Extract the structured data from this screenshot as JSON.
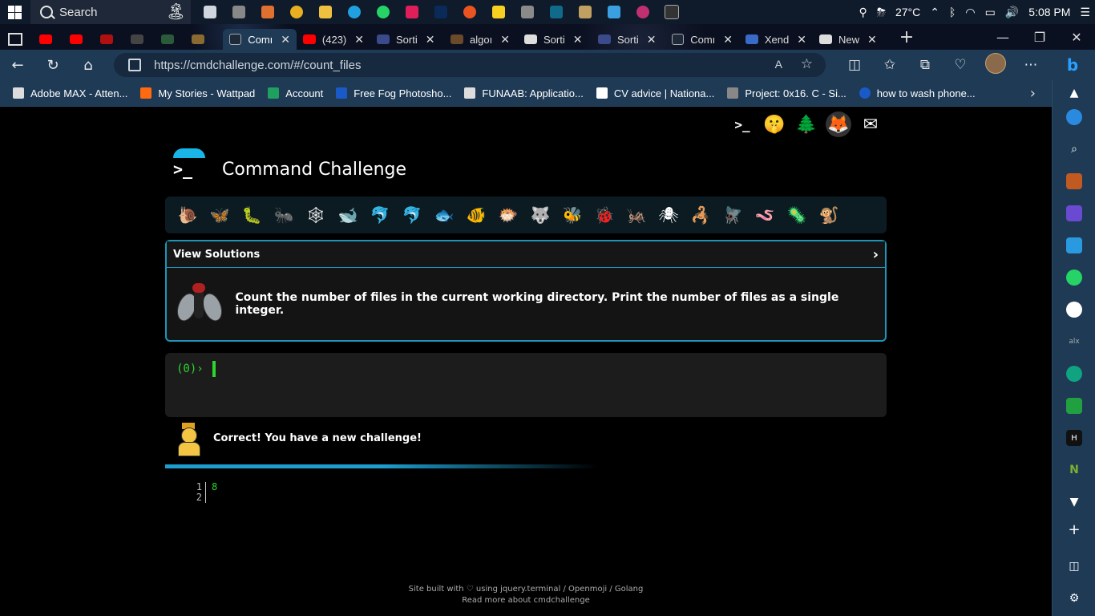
{
  "taskbar": {
    "search_label": "Search",
    "weather": "27°C",
    "time": "5:08 PM"
  },
  "tabs": [
    {
      "label": "",
      "color": "#ff0000"
    },
    {
      "label": "",
      "color": "#ff0000"
    },
    {
      "label": "",
      "color": "#b01010"
    },
    {
      "label": "",
      "color": "#444444"
    },
    {
      "label": "",
      "color": "#2a5a3a"
    },
    {
      "label": "",
      "color": "#8a6a30"
    },
    {
      "label": "Comı",
      "color": "#1e2a3a",
      "active": true
    },
    {
      "label": "(423)",
      "color": "#ff0000"
    },
    {
      "label": "Sorti",
      "color": "#3a4a8a"
    },
    {
      "label": "algoı",
      "color": "#6a4a2a"
    },
    {
      "label": "Sorti",
      "color": "#dddddd"
    },
    {
      "label": "Sorti",
      "color": "#3a4a8a"
    },
    {
      "label": "Comı",
      "color": "#1e2a3a"
    },
    {
      "label": "Xend",
      "color": "#3a6ac8"
    },
    {
      "label": "New",
      "color": "#dddddd"
    }
  ],
  "address": {
    "url": "https://cmdchallenge.com/#/count_files"
  },
  "bookmarks": [
    {
      "label": "Adobe MAX - Atten...",
      "color": "#dddddd"
    },
    {
      "label": "My Stories - Wattpad",
      "color": "#ff6a10"
    },
    {
      "label": "Account",
      "color": "#20a060"
    },
    {
      "label": "Free Fog Photosho...",
      "color": "#1a5ac8"
    },
    {
      "label": "FUNAAB: Applicatio...",
      "color": "#dddddd"
    },
    {
      "label": "CV advice | Nationa...",
      "color": "#ffffff"
    },
    {
      "label": "Project: 0x16. C - Si...",
      "color": "#888888"
    },
    {
      "label": "how to wash phone...",
      "color": "#1a5ac8"
    }
  ],
  "page": {
    "title": "Command Challenge",
    "logo_prompt": ">_",
    "view_solutions": "View Solutions",
    "chevron": "›",
    "challenge_text": "Count the number of files in the current working directory. Print the number of files as a single integer.",
    "prompt": "(0)›",
    "status_message": "Correct! You have a new challenge!",
    "output_lines": [
      "1",
      "2"
    ],
    "output_value": "8",
    "footer_line1": "Site built with ♡ using jquery.terminal / Openmoji / Golang",
    "footer_line2": "Read more about cmdchallenge"
  },
  "emoji_strip": [
    "🐌",
    "🦋",
    "🐛",
    "🐜",
    "🕸",
    "🐋",
    "🐬",
    "🐬",
    "🐟",
    "🐠",
    "🐡",
    "🐺",
    "🐝",
    "🐞",
    "🦗",
    "🕷",
    "🦂",
    "🪰",
    "🪱",
    "🦠",
    "🐒"
  ],
  "top_icons": [
    "terminal-icon",
    "hint-icon",
    "tree-icon",
    "gitlab-icon",
    "mail-icon"
  ],
  "colors": {
    "accent": "#1d94b8",
    "prompt_green": "#2ed52e",
    "browser_chrome": "#1e3a55"
  }
}
